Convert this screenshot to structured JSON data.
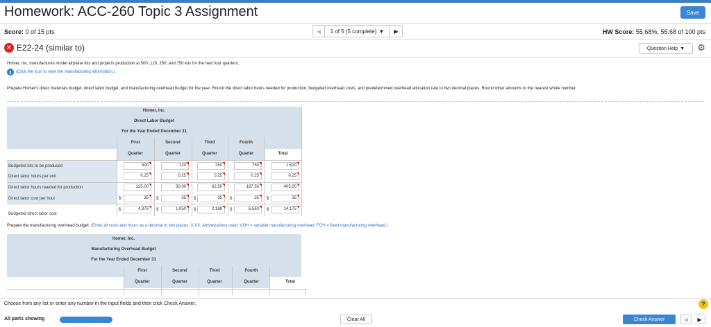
{
  "header": {
    "title": "Homework: ACC-260 Topic 3 Assignment",
    "save_label": "Save",
    "score_label": "Score:",
    "score_value": "0 of 15 pts",
    "pager_text": "1 of 5 (5 complete)",
    "hw_label": "HW Score:",
    "hw_value": "55.68%, 55.68 of 100 pts"
  },
  "question": {
    "id": "E22-24 (similar to)",
    "help_label": "Question Help",
    "intro": "Homer, Inc. manufactures model airplane kits and projects production at 500, 120, 250, and 750 kits for the next four quarters.",
    "info_link": "(Click the icon to view the manufacturing information.)",
    "instructions": "Prepare Homer's direct materials budget, direct labor budget, and manufacturing overhead budget for the year. Round the direct labor hours needed for production, budgeted overhead costs, and predetermined overhead allocation rate to two decimal places. Round other amounts to the nearest whole number."
  },
  "labor_budget": {
    "company": "Homer, Inc.",
    "name": "Direct Labor Budget",
    "period": "For the Year Ended December 31",
    "col_top": [
      "First",
      "Second",
      "Third",
      "Fourth",
      ""
    ],
    "col_bottom": [
      "Quarter",
      "Quarter",
      "Quarter",
      "Quarter",
      "Total"
    ],
    "row_labels": [
      "Budgeted kits to be produced",
      "Direct labor hours per unit",
      "Direct labor hours needed for production",
      "Direct labor cost per hour",
      "Budgeted direct labor cost"
    ],
    "dollar": "$",
    "rows": [
      [
        "500",
        "120",
        "250",
        "750",
        "1,620"
      ],
      [
        "0.25",
        "0.25",
        "0.25",
        "0.25",
        "0.25"
      ],
      [
        "125.00",
        "30.00",
        "62.50",
        "187.50",
        "405.00"
      ],
      [
        "35",
        "35",
        "35",
        "35",
        "35"
      ],
      [
        "4,375",
        "1,050",
        "2,188",
        "6,563",
        "14,175"
      ]
    ]
  },
  "overhead_note": {
    "lead": "Prepare the manufacturing overhead budget.",
    "hint": "(Enter all costs and hours as a decimal to two places, X.XX. Abbreviations used: VOH = variable manufacturing overhead; FOH = fixed manufacturing overhead.)"
  },
  "overhead_budget": {
    "company": "Homer, Inc.",
    "name": "Manufacturing Overhead Budget",
    "period": "For the Year Ended December 31",
    "col_top": [
      "First",
      "Second",
      "Third",
      "Fourth",
      ""
    ],
    "col_bottom": [
      "Quarter",
      "Quarter",
      "Quarter",
      "Quarter",
      "Total"
    ]
  },
  "footer": {
    "instruction": "Choose from any list or enter any number in the input fields and then click Check Answer.",
    "all_parts": "All parts showing",
    "progress": 1.0,
    "clear_label": "Clear All",
    "check_label": "Check Answer"
  },
  "colors": {
    "accent": "#3a86d4",
    "header_bg": "#d6e0ea",
    "error": "#d22222"
  }
}
